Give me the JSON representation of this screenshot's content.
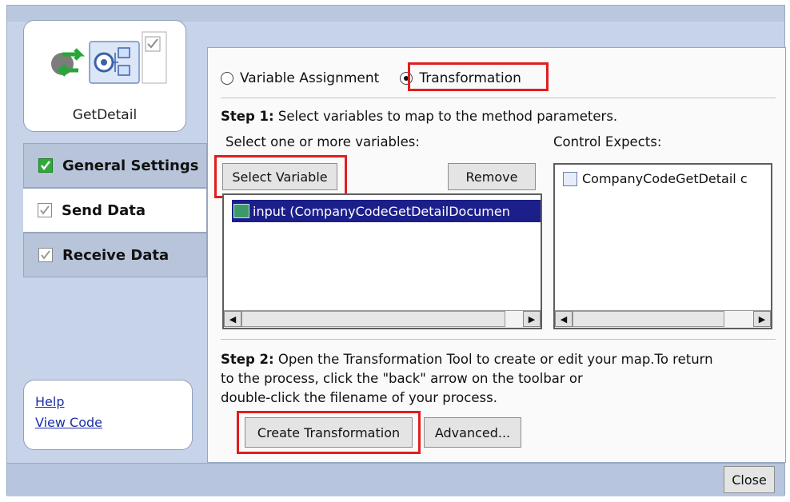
{
  "icon_card": {
    "title": "GetDetail"
  },
  "nav": {
    "general": "General Settings",
    "send": "Send Data",
    "receive": "Receive Data"
  },
  "help": {
    "help_link": "Help",
    "view_code_link": "View Code"
  },
  "main": {
    "radio_variable": "Variable Assignment",
    "radio_transformation": "Transformation",
    "selected_radio": "Transformation",
    "step1_bold": "Step 1:",
    "step1_text": " Select variables to map to the method parameters.",
    "select_label": "Select one or more variables:",
    "control_label": "Control Expects:",
    "select_variable_button": "Select Variable",
    "remove_button": "Remove",
    "variables_list": [
      "input (CompanyCodeGetDetailDocumen"
    ],
    "expects_list": [
      "CompanyCodeGetDetail c"
    ],
    "step2_bold": "Step 2:",
    "step2_text_line1": " Open the Transformation Tool to create or edit your map.To return",
    "step2_text_line2": "to the process, click the \"back\" arrow on the toolbar or",
    "step2_text_line3": "double-click the filename of your process.",
    "create_button": "Create Transformation",
    "advanced_button": "Advanced..."
  },
  "footer": {
    "close_button": "Close"
  },
  "colors": {
    "highlight": "#e01e1e",
    "selection": "#1c1f8a",
    "panel_bg": "#c6d3e8"
  }
}
